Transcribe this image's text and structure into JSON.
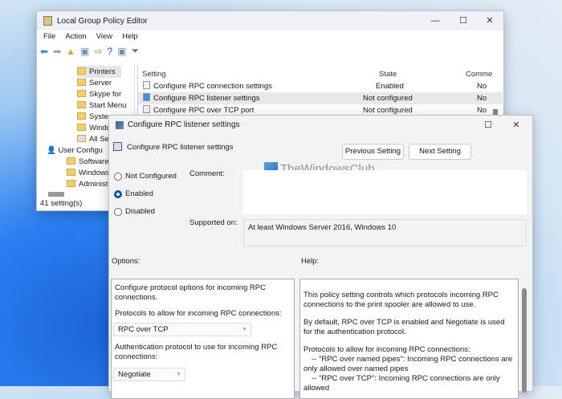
{
  "main_window": {
    "title": "Local Group Policy Editor",
    "menu": [
      "File",
      "Action",
      "View",
      "Help"
    ],
    "tree": [
      "Printers",
      "Server",
      "Skype for",
      "Start Menu",
      "System",
      "Windows",
      "All Se",
      "User Configu",
      "Software",
      "Windows",
      "Administ"
    ],
    "status": "41 setting(s)",
    "columns": [
      "Setting",
      "State",
      "Comme"
    ],
    "rows": [
      {
        "setting": "Configure RPC connection settings",
        "state": "Enabled",
        "comment": "No"
      },
      {
        "setting": "Configure RPC listener settings",
        "state": "Not configured",
        "comment": "No"
      },
      {
        "setting": "Configure RPC over TCP port",
        "state": "Not configured",
        "comment": "No"
      }
    ]
  },
  "dialog": {
    "title": "Configure RPC listener settings",
    "heading": "Configure RPC listener settings",
    "prev_label": "Previous Setting",
    "next_label": "Next Setting",
    "radios": [
      "Not Configured",
      "Enabled",
      "Disabled"
    ],
    "selected": "Enabled",
    "comment_label": "Comment:",
    "comment_value": "",
    "supported_label": "Supported on:",
    "supported_value": "At least Windows Server 2016, Windows 10",
    "options_label": "Options:",
    "help_label": "Help:",
    "options": {
      "intro": "Configure protocol options for incoming RPC connections.",
      "protocols_label": "Protocols to allow for incoming RPC connections:",
      "protocols_value": "RPC over TCP",
      "auth_label": "Authentication protocol to use for incoming RPC connections:",
      "auth_value": "Negotiate"
    },
    "help": [
      "This policy setting controls which protocols incoming RPC connections to the print spooler are allowed to use.",
      "By default, RPC over TCP is enabled and Negotiate is used for the authentication protocol.",
      "Protocols to allow for incoming RPC connections:",
      "-- \"RPC over named pipes\": Incoming RPC connections are only allowed over named pipes",
      "-- \"RPC over TCP\": Incoming RPC connections are only allowed"
    ]
  },
  "watermark": "TheWindowsClub"
}
